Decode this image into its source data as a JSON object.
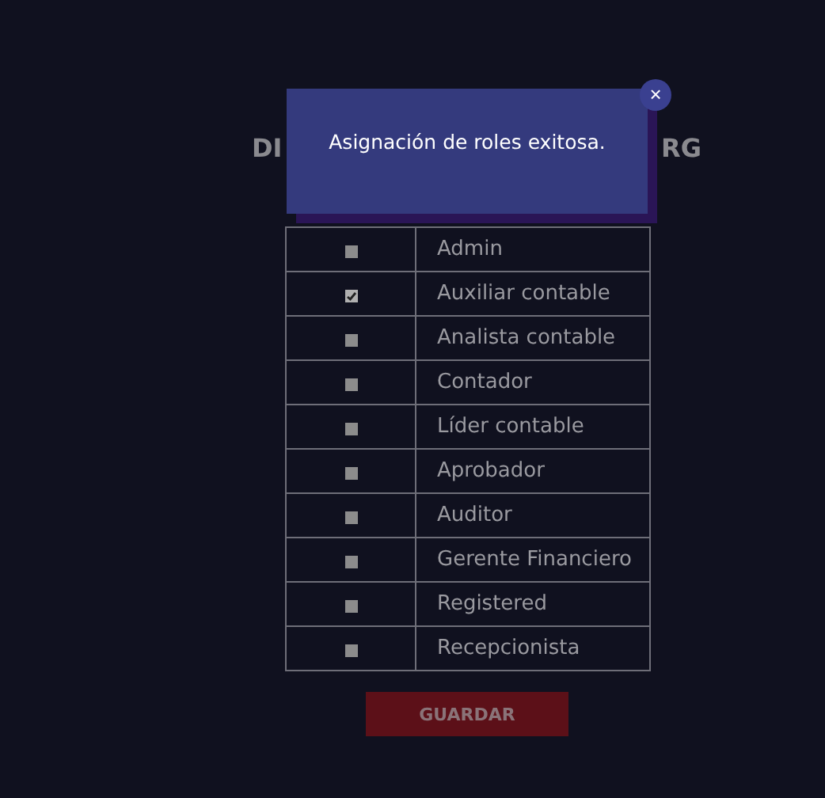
{
  "heading": {
    "visible_start": "DI",
    "visible_end": "RG"
  },
  "dialog": {
    "message": "Asignación de roles exitosa.",
    "close": "×"
  },
  "roles": [
    {
      "name": "Admin",
      "checked": false
    },
    {
      "name": "Auxiliar contable",
      "checked": true
    },
    {
      "name": "Analista contable",
      "checked": false
    },
    {
      "name": "Contador",
      "checked": false
    },
    {
      "name": "Líder contable",
      "checked": false
    },
    {
      "name": "Aprobador",
      "checked": false
    },
    {
      "name": "Auditor",
      "checked": false
    },
    {
      "name": "Gerente Financiero",
      "checked": false
    },
    {
      "name": "Registered",
      "checked": false
    },
    {
      "name": "Recepcionista",
      "checked": false
    }
  ],
  "save_button": "GUARDAR"
}
